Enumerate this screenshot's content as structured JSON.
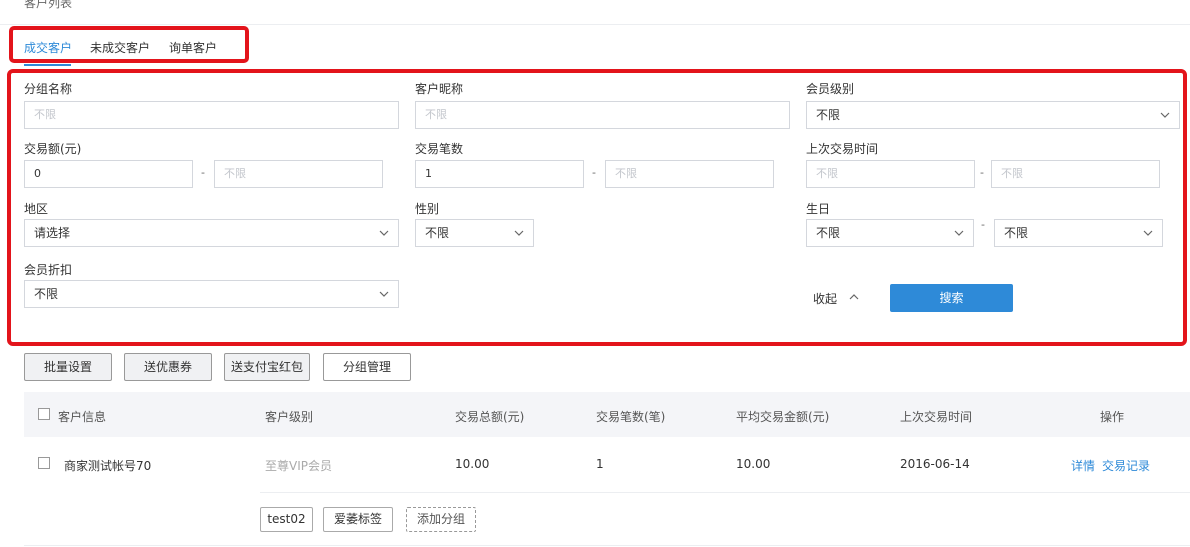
{
  "page": {
    "title": "客户列表"
  },
  "tabs": [
    {
      "label": "成交客户"
    },
    {
      "label": "未成交客户"
    },
    {
      "label": "询单客户"
    }
  ],
  "filters": {
    "group_name": {
      "label": "分组名称",
      "placeholder": "不限"
    },
    "nickname": {
      "label": "客户昵称",
      "placeholder": "不限"
    },
    "member_level": {
      "label": "会员级别",
      "value": "不限"
    },
    "amount": {
      "label": "交易额(元)",
      "min": "0",
      "max_placeholder": "不限"
    },
    "count": {
      "label": "交易笔数",
      "min": "1",
      "max_placeholder": "不限"
    },
    "last_time": {
      "label": "上次交易时间",
      "min_placeholder": "不限",
      "max_placeholder": "不限"
    },
    "region": {
      "label": "地区",
      "value": "请选择"
    },
    "gender": {
      "label": "性别",
      "value": "不限"
    },
    "birthday": {
      "label": "生日",
      "month": "不限",
      "day": "不限"
    },
    "discount": {
      "label": "会员折扣",
      "value": "不限"
    },
    "range_sep": "-",
    "birthday_sep": "-",
    "collapse_label": "收起",
    "search_label": "搜索"
  },
  "actions": {
    "batch_settings": "批量设置",
    "send_coupon": "送优惠券",
    "send_alipay": "送支付宝红包",
    "group_manage": "分组管理"
  },
  "table": {
    "columns": [
      "客户信息",
      "客户级别",
      "交易总额(元)",
      "交易笔数(笔)",
      "平均交易金额(元)",
      "上次交易时间",
      "操作"
    ],
    "rows": [
      {
        "name": "商家测试帐号70",
        "level": "至尊VIP会员",
        "total": "10.00",
        "count": "1",
        "avg": "10.00",
        "last": "2016-06-14",
        "detail": "详情",
        "records": "交易记录",
        "tags": [
          "test02",
          "爱萎标签"
        ],
        "add_group": "添加分组"
      }
    ]
  },
  "colors": {
    "accent": "#2e8ad8",
    "highlight": "#e3141b"
  }
}
